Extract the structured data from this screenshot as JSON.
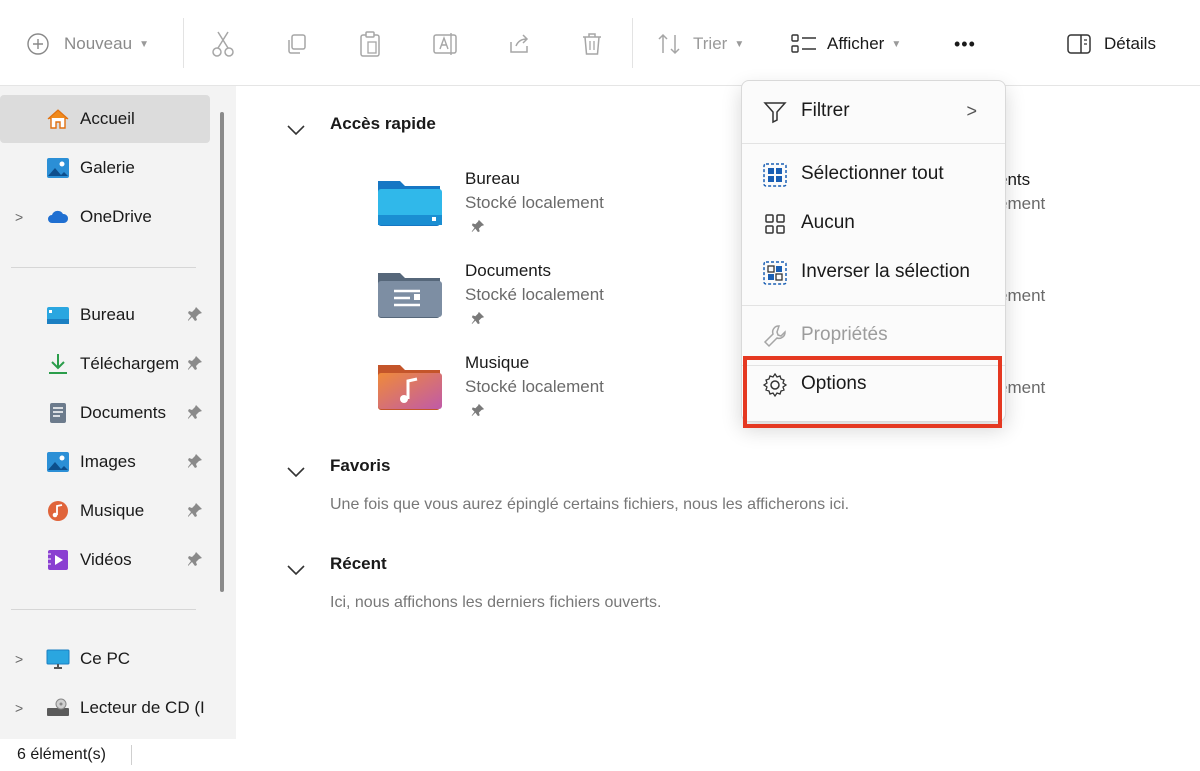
{
  "toolbar": {
    "new_label": "Nouveau",
    "sort_label": "Trier",
    "view_label": "Afficher",
    "more_label": "•••",
    "details_label": "Détails"
  },
  "sidebar": {
    "home": "Accueil",
    "gallery": "Galerie",
    "onedrive": "OneDrive",
    "pinned": [
      {
        "label": "Bureau"
      },
      {
        "label": "Téléchargem"
      },
      {
        "label": "Documents"
      },
      {
        "label": "Images"
      },
      {
        "label": "Musique"
      },
      {
        "label": "Vidéos"
      }
    ],
    "this_pc": "Ce PC",
    "cd_drive": "Lecteur de CD (I"
  },
  "main": {
    "quick_access": {
      "title": "Accès rapide",
      "items": [
        {
          "name": "Bureau",
          "sub": "Stocké localement"
        },
        {
          "name": "Documents",
          "sub": "Stocké localement"
        },
        {
          "name": "Musique",
          "sub": "Stocké localement"
        }
      ],
      "peek": [
        "ents",
        "ement",
        "ement",
        "ement"
      ]
    },
    "favorites": {
      "title": "Favoris",
      "empty": "Une fois que vous aurez épinglé certains fichiers, nous les afficherons ici."
    },
    "recent": {
      "title": "Récent",
      "empty": "Ici, nous affichons les derniers fichiers ouverts."
    }
  },
  "status": {
    "count": "6 élément(s)"
  },
  "menu": {
    "filter": "Filtrer",
    "select_all": "Sélectionner tout",
    "none": "Aucun",
    "invert": "Inverser la sélection",
    "properties": "Propriétés",
    "options": "Options"
  },
  "colors": {
    "highlight": "#e53821",
    "folder_blue": "#2b8fd6",
    "onedrive": "#1f6fd1",
    "download": "#2a9d4a",
    "video": "#8a3fd1"
  }
}
